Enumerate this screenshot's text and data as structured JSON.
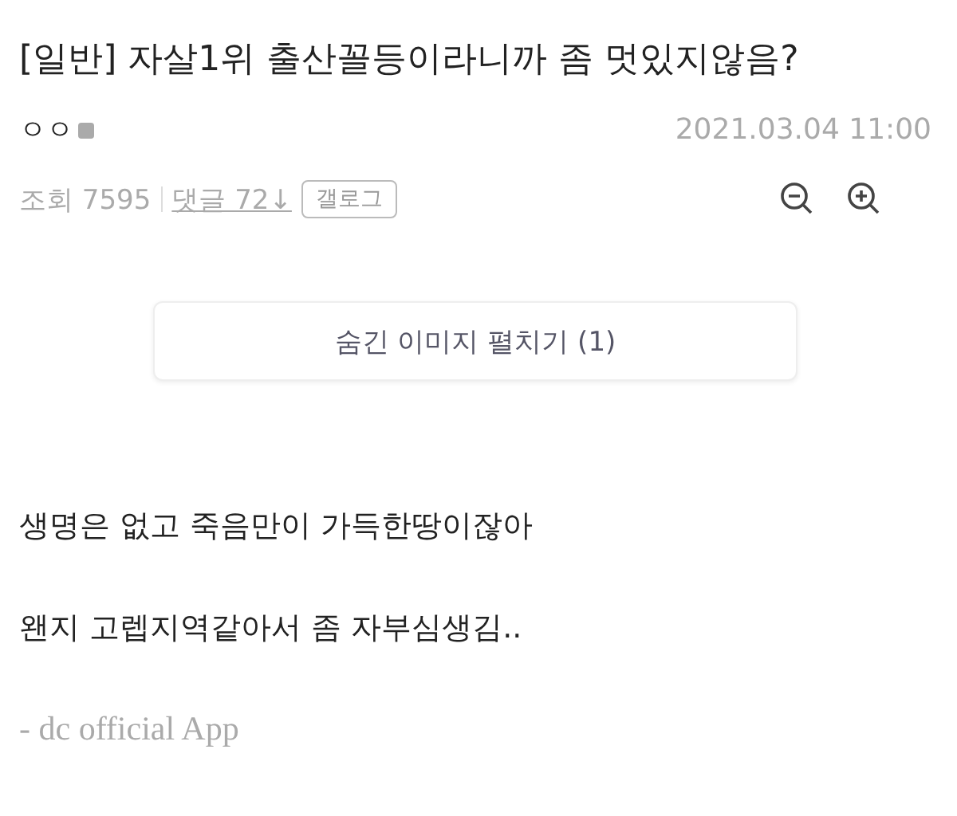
{
  "post": {
    "title": "[일반] 자살1위 출산꼴등이라니까 좀 멋있지않음?",
    "author": "ㅇㅇ",
    "date": "2021.03.04 11:00",
    "views": "조회 7595",
    "comments": "댓글 72↓",
    "tag": "갤로그",
    "hidden_images_button": "숨긴 이미지 펼치기 (1)",
    "body": [
      "생명은 없고 죽음만이 가득한땅이잖아",
      "왠지 고렙지역같아서 좀 자부심생김.."
    ],
    "signature": "- dc official App"
  }
}
